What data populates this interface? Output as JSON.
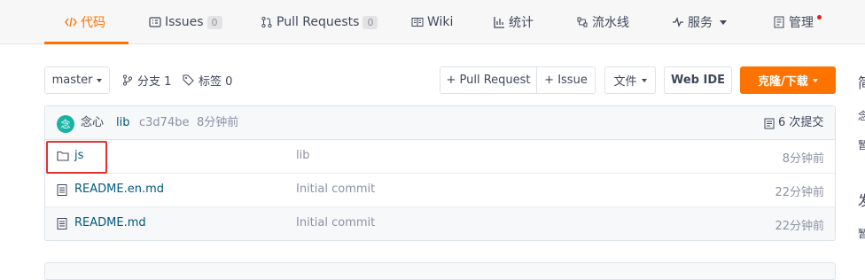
{
  "tabs": [
    {
      "label": "代码",
      "icon": "code-icon"
    },
    {
      "label": "Issues",
      "count": "0",
      "icon": "issues-icon"
    },
    {
      "label": "Pull Requests",
      "count": "0",
      "icon": "pull-request-icon"
    },
    {
      "label": "Wiki",
      "icon": "wiki-icon"
    },
    {
      "label": "统计",
      "icon": "stats-icon"
    },
    {
      "label": "流水线",
      "icon": "pipeline-icon"
    },
    {
      "label": "服务",
      "icon": "service-icon"
    },
    {
      "label": "管理",
      "icon": "settings-icon"
    }
  ],
  "toolbar": {
    "branch": "master",
    "branches": "分支 1",
    "tags": "标签 0",
    "pull_request": "+ Pull Request",
    "issue": "+ Issue",
    "files": "文件",
    "web_ide": "Web IDE",
    "clone": "克隆/下载"
  },
  "commit": {
    "avatar_text": "念",
    "author": "念心",
    "message": "lib",
    "hash": "c3d74be",
    "time": "8分钟前",
    "commits": "6 次提交"
  },
  "files": [
    {
      "name": "js",
      "type": "folder",
      "message": "lib",
      "time": "8分钟前"
    },
    {
      "name": "README.en.md",
      "type": "file",
      "message": "Initial commit",
      "time": "22分钟前"
    },
    {
      "name": "README.md",
      "type": "file",
      "message": "Initial commit",
      "time": "22分钟前"
    }
  ],
  "sidebar_fragments": [
    "简",
    "念",
    "暂",
    "发",
    "暂"
  ]
}
